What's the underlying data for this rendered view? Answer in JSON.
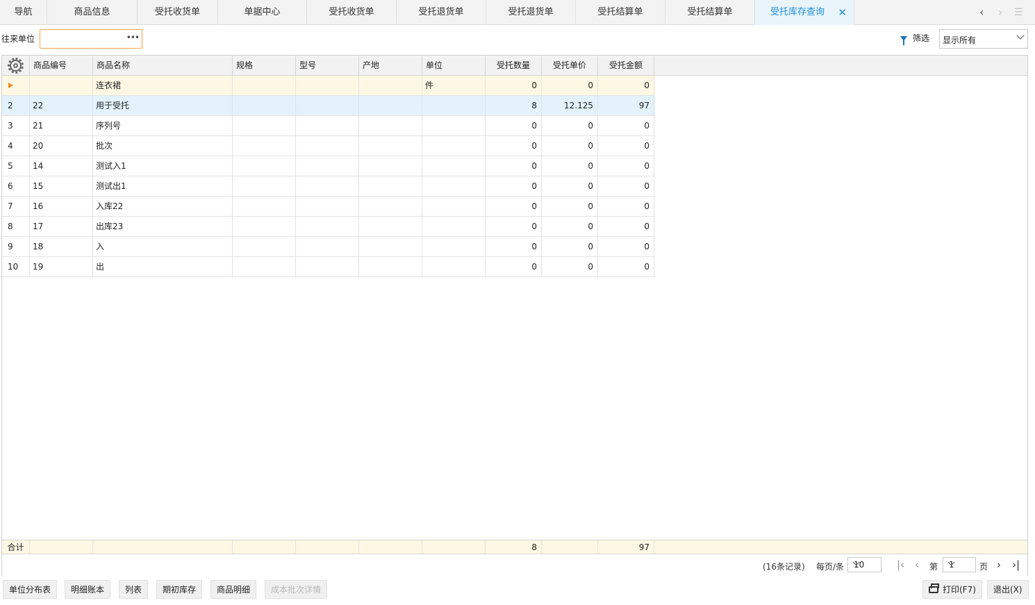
{
  "tabs": [
    {
      "label": "导航"
    },
    {
      "label": "商品信息"
    },
    {
      "label": "受托收货单"
    },
    {
      "label": "单据中心"
    },
    {
      "label": "受托收货单"
    },
    {
      "label": "受托退货单"
    },
    {
      "label": "受托退货单"
    },
    {
      "label": "受托结算单"
    },
    {
      "label": "受托结算单"
    },
    {
      "label": "受托库存查询",
      "active": true
    }
  ],
  "filter": {
    "partner_label": "往来单位",
    "partner_value": "",
    "more_glyph": "•••",
    "filter_label": "筛选",
    "show_value": "显示所有"
  },
  "grid": {
    "columns": [
      "商品编号",
      "商品名称",
      "规格",
      "型号",
      "产地",
      "单位",
      "受托数量",
      "受托单价",
      "受托金额"
    ],
    "rows": [
      {
        "idx": "",
        "code": "",
        "name": "连衣裙",
        "spec": "",
        "model": "",
        "origin": "",
        "unit": "件",
        "qty": "0",
        "price": "0",
        "amount": "0"
      },
      {
        "idx": "2",
        "code": "22",
        "name": "用于受托",
        "spec": "",
        "model": "",
        "origin": "",
        "unit": "",
        "qty": "8",
        "price": "12.125",
        "amount": "97"
      },
      {
        "idx": "3",
        "code": "21",
        "name": "序列号",
        "spec": "",
        "model": "",
        "origin": "",
        "unit": "",
        "qty": "0",
        "price": "0",
        "amount": "0"
      },
      {
        "idx": "4",
        "code": "20",
        "name": "批次",
        "spec": "",
        "model": "",
        "origin": "",
        "unit": "",
        "qty": "0",
        "price": "0",
        "amount": "0"
      },
      {
        "idx": "5",
        "code": "14",
        "name": "测试入1",
        "spec": "",
        "model": "",
        "origin": "",
        "unit": "",
        "qty": "0",
        "price": "0",
        "amount": "0"
      },
      {
        "idx": "6",
        "code": "15",
        "name": "测试出1",
        "spec": "",
        "model": "",
        "origin": "",
        "unit": "",
        "qty": "0",
        "price": "0",
        "amount": "0"
      },
      {
        "idx": "7",
        "code": "16",
        "name": "入库22",
        "spec": "",
        "model": "",
        "origin": "",
        "unit": "",
        "qty": "0",
        "price": "0",
        "amount": "0"
      },
      {
        "idx": "8",
        "code": "17",
        "name": "出库23",
        "spec": "",
        "model": "",
        "origin": "",
        "unit": "",
        "qty": "0",
        "price": "0",
        "amount": "0"
      },
      {
        "idx": "9",
        "code": "18",
        "name": "入",
        "spec": "",
        "model": "",
        "origin": "",
        "unit": "",
        "qty": "0",
        "price": "0",
        "amount": "0"
      },
      {
        "idx": "10",
        "code": "19",
        "name": "出",
        "spec": "",
        "model": "",
        "origin": "",
        "unit": "",
        "qty": "0",
        "price": "0",
        "amount": "0"
      }
    ],
    "footer": {
      "label": "合计",
      "qty": "8",
      "amount": "97"
    }
  },
  "pager": {
    "records": "(16条记录)",
    "perpage_label": "每页/条",
    "perpage_value": "10",
    "page_prefix": "第",
    "page_value": "1",
    "page_suffix": "页"
  },
  "toolbar": {
    "unit_dist": "单位分布表",
    "detail_ledger": "明细账本",
    "list": "列表",
    "opening_stock": "期初库存",
    "product_detail": "商品明细",
    "cost_batch": "成本批次详情",
    "print": "打印(F7)",
    "exit": "退出(X)"
  }
}
